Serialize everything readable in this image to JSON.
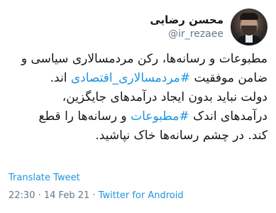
{
  "author": {
    "display_name": "محسن رضایی",
    "handle": "@ir_rezaee"
  },
  "tweet": {
    "lines": [
      [
        "مطبوعات و رسانه‌ها، رکن مردمسالاری سیاسی و"
      ],
      [
        "ضامن موفقیت ",
        "#مردمسالاری_اقتصادی",
        " اند."
      ],
      [
        "دولت نباید بدون ایجاد درآمدهای جایگزین،"
      ],
      [
        "درآمدهای اندک ",
        "#مطبوعات",
        " و رسانه‌ها را قطع"
      ],
      [
        "کند. در چشم رسانه‌ها خاک نپاشید."
      ]
    ],
    "translate_label": "Translate Tweet",
    "time": "22:30",
    "separator_1": " · ",
    "date": "14 Feb 21",
    "separator_2": " · ",
    "source": "Twitter for Android"
  },
  "colors": {
    "link": "#1b95e0",
    "secondary_text": "#657786",
    "primary_text": "#14171a"
  }
}
